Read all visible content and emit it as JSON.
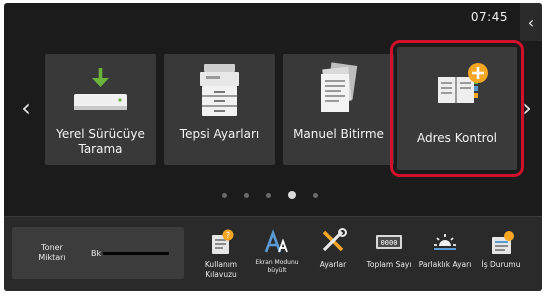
{
  "status": {
    "time": "07:45"
  },
  "nav": {
    "prev_glyph": "‹",
    "next_glyph": "›",
    "side_tab_glyph": "‹"
  },
  "tiles": [
    {
      "label": "Yerel Sürücüye Tarama",
      "icon": "scan-to-drive-icon"
    },
    {
      "label": "Tepsi Ayarları",
      "icon": "printer-tray-icon"
    },
    {
      "label": "Manuel Bitirme",
      "icon": "manual-finishing-icon"
    },
    {
      "label": "Adres Kontrol",
      "icon": "address-book-add-icon",
      "highlighted": true
    }
  ],
  "pagination": {
    "total": 5,
    "active_index": 3
  },
  "toner": {
    "label": "Toner Miktarı",
    "color_code": "Bk",
    "level_percent": 100
  },
  "quick_actions": [
    {
      "label": "Kullanım Kılavuzu",
      "icon": "manual-book-icon"
    },
    {
      "label": "Ekran Modunu büyült",
      "icon": "text-size-icon"
    },
    {
      "label": "Ayarlar",
      "icon": "tools-icon"
    },
    {
      "label": "Toplam Sayı",
      "icon": "counter-icon",
      "counter_text": "0000"
    },
    {
      "label": "Parlaklık Ayarı",
      "icon": "brightness-icon"
    },
    {
      "label": "İş Durumu",
      "icon": "job-status-icon"
    }
  ],
  "colors": {
    "highlight": "#d0112b",
    "accent_orange": "#f5a623",
    "icon_green": "#6ab43a",
    "icon_blue": "#5b9bd5"
  }
}
